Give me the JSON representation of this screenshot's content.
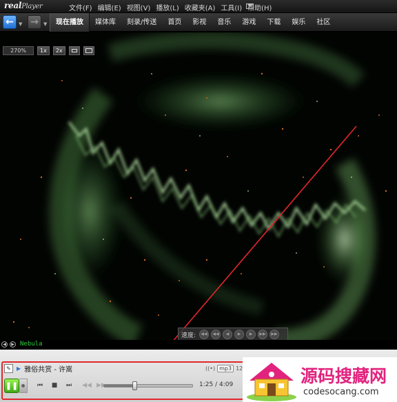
{
  "app": {
    "logo_main": "real",
    "logo_sub": "Player"
  },
  "menu": [
    "文件(F)",
    "编辑(E)",
    "视图(V)",
    "播放(L)",
    "收藏夹(A)",
    "工具(I)",
    "帮助(H)"
  ],
  "nav": {
    "tabs": [
      {
        "label": "现在播放",
        "active": true
      },
      {
        "label": "媒体库",
        "active": false
      },
      {
        "label": "刻录/传送",
        "active": false
      },
      {
        "label": "首页",
        "active": false
      },
      {
        "label": "影视",
        "active": false
      },
      {
        "label": "音乐",
        "active": false
      },
      {
        "label": "游戏",
        "active": false
      },
      {
        "label": "下载",
        "active": false
      },
      {
        "label": "娱乐",
        "active": false
      },
      {
        "label": "社区",
        "active": false
      }
    ]
  },
  "video": {
    "zoom_value": "270%",
    "zoom_1x": "1x",
    "zoom_2x": "2x",
    "speed_label": "速度:",
    "visualization": "Nebula"
  },
  "player": {
    "track_title": "雅俗共赏 - 许嵩",
    "format_badge": "mp3",
    "bitrate": "128",
    "elapsed": "1:25",
    "duration": "4:09",
    "time_text": "1:25 / 4:09",
    "progress_fraction": 0.341
  },
  "watermark": {
    "title": "源码搜藏网",
    "url": "codesocang.com"
  },
  "colors": {
    "accent_green": "#3fa814",
    "annotation_red": "#e3262b",
    "watermark_pink": "#e2237e",
    "vis_green": "#2ecf3a"
  }
}
